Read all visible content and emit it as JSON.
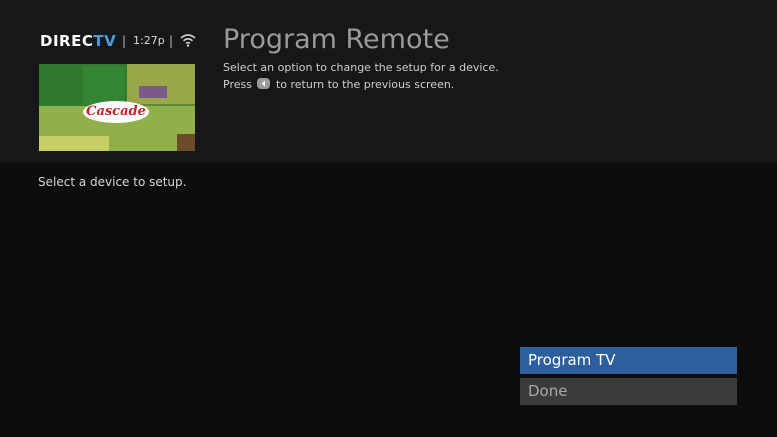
{
  "header": {
    "logo_main": "DIREC",
    "logo_accent": "TV",
    "separator": "|",
    "time": "1:27p",
    "title": "Program Remote",
    "desc_line1": "Select an option to change the setup for a device.",
    "desc_press": "Press",
    "desc_rest": "to return to the previous screen."
  },
  "thumbnail": {
    "label": "Cascade"
  },
  "prompt": "Select a device to setup.",
  "menu": [
    {
      "label": "Program TV",
      "selected": true
    },
    {
      "label": "Done",
      "selected": false
    }
  ],
  "colors": {
    "selected_bg": "#2d5e9e",
    "logo_accent": "#4f9be0"
  },
  "icons": {
    "wifi": "wifi-icon",
    "back": "back-button-icon"
  }
}
